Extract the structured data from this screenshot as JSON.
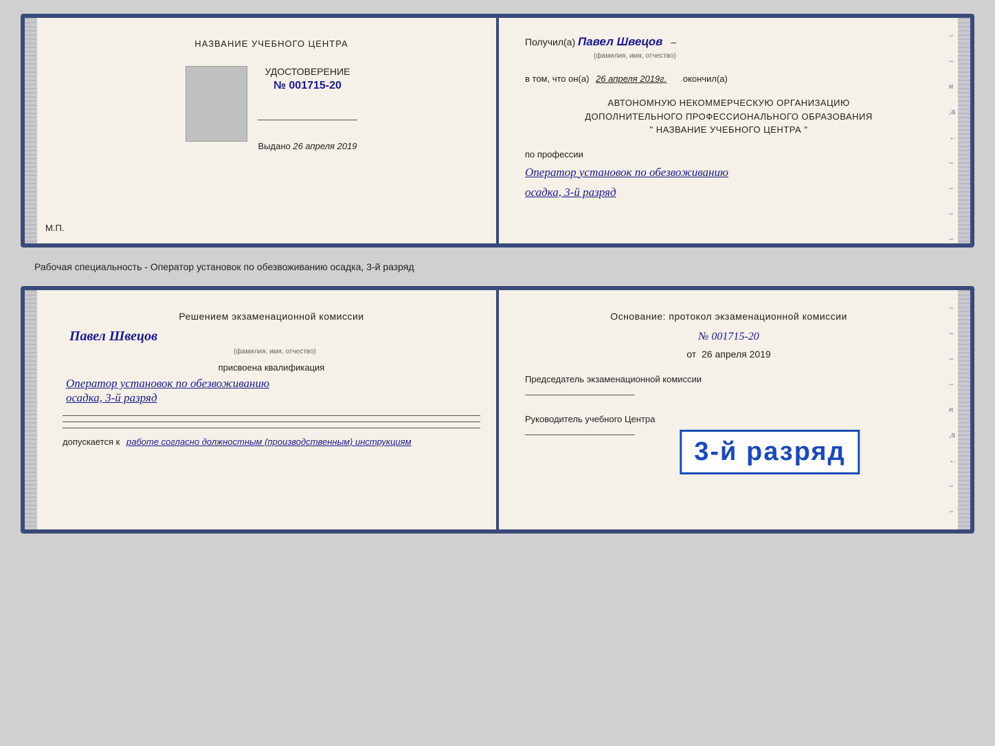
{
  "doc1": {
    "left": {
      "training_center_title": "НАЗВАНИЕ УЧЕБНОГО ЦЕНТРА",
      "udostoverenie": "УДОСТОВЕРЕНИЕ",
      "number_prefix": "№",
      "number": "001715-20",
      "issued_label": "Выдано",
      "issued_date": "26 апреля 2019",
      "mp_label": "М.П."
    },
    "right": {
      "received_prefix": "Получил(а)",
      "received_name": "Павел Швецов",
      "fio_hint": "(фамилия, имя, отчество)",
      "dash": "–",
      "in_that_prefix": "в том, что он(а)",
      "in_that_date": "26 апреля 2019г.",
      "finished": "окончил(а)",
      "org_line1": "АВТОНОМНУЮ НЕКОММЕРЧЕСКУЮ ОРГАНИЗАЦИЮ",
      "org_line2": "ДОПОЛНИТЕЛЬНОГО ПРОФЕССИОНАЛЬНОГО ОБРАЗОВАНИЯ",
      "org_line3": "\"  НАЗВАНИЕ УЧЕБНОГО ЦЕНТРА  \"",
      "profession_label": "по профессии",
      "profession_value": "Оператор установок по обезвоживанию",
      "rank_value": "осадка, 3-й разряд"
    }
  },
  "separator": {
    "text": "Рабочая специальность - Оператор установок по обезвоживанию осадка, 3-й разряд"
  },
  "doc2": {
    "left": {
      "commission_title": "Решением экзаменационной комиссии",
      "person_name": "Павел Швецов",
      "fio_hint": "(фамилия, имя, отчество)",
      "assigned_label": "присвоена квалификация",
      "qual_value": "Оператор установок по обезвоживанию",
      "rank_value": "осадка, 3-й разряд",
      "допускается_prefix": "допускается к",
      "допускается_value": "работе согласно должностным (производственным) инструкциям"
    },
    "right": {
      "basis_title": "Основание: протокол экзаменационной комиссии",
      "protocol_prefix": "№",
      "protocol_number": "001715-20",
      "from_prefix": "от",
      "from_date": "26 апреля 2019",
      "chairman_label": "Председатель экзаменационной комиссии",
      "head_label": "Руководитель учебного Центра"
    },
    "stamp": {
      "text": "3-й разряд"
    }
  }
}
